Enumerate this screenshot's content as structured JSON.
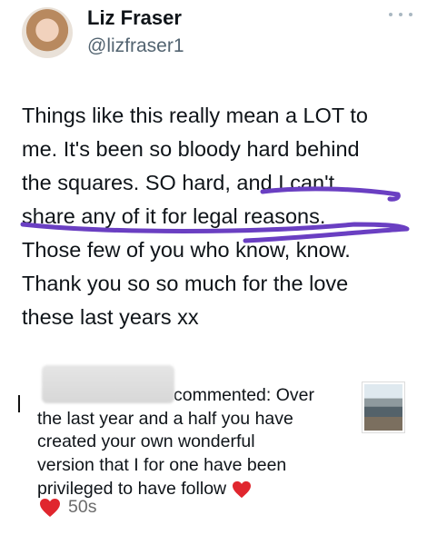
{
  "author": {
    "name": "Liz Fraser",
    "handle": "@lizfraser1"
  },
  "tweet": {
    "lines": [
      "Things like this really mean a LOT to",
      "me. It's been so bloody hard behind",
      "the squares. SO hard, and I can't",
      "share any of it for legal reasons.",
      "Those few of you who know, know.",
      "Thank you so so much for the love",
      "these last years xx"
    ]
  },
  "notification": {
    "text_lines": [
      "commented: Over",
      "the last year and a half you have",
      "created your own wonderful",
      "version that I for one have been",
      "privileged  to have  follow"
    ],
    "time": "50s"
  },
  "colors": {
    "scribble": "#6a3fc2",
    "heart": "#e0262e",
    "handle": "#536471"
  },
  "icons": {
    "more": "more-icon",
    "heart": "heart-icon"
  }
}
